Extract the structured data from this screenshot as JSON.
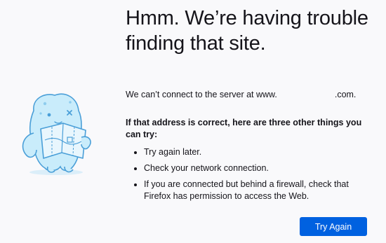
{
  "error": {
    "title": "Hmm. We’re having trouble finding that site.",
    "description_prefix": "We can’t connect to the server at www.",
    "description_suffix": ".com.",
    "subheading": "If that address is correct, here are three other things you can try:",
    "suggestions": [
      "Try again later.",
      "Check your network connection.",
      "If you are connected but behind a firewall, check that Firefox has permission to access the Web."
    ],
    "try_again_label": "Try Again"
  },
  "colors": {
    "background": "#f9f9fb",
    "primary_button": "#0061e0",
    "illustration_blue": "#bde6fa",
    "illustration_outline": "#4a9fd8"
  },
  "icons": {
    "illustration": "confused-monster-holding-map"
  }
}
